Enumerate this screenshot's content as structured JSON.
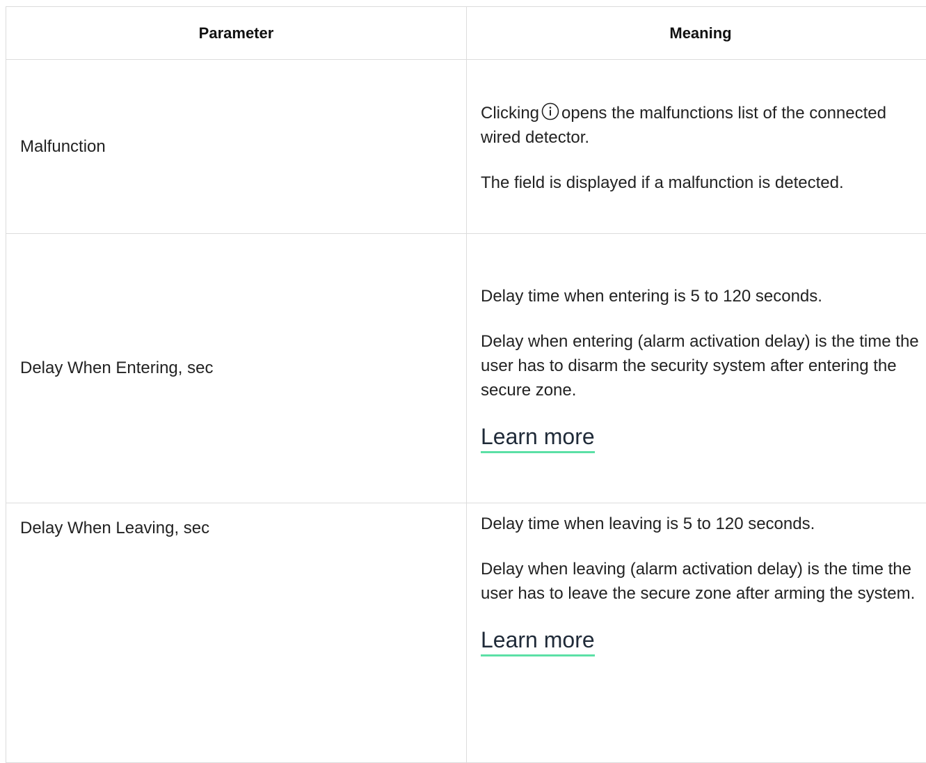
{
  "table": {
    "headers": {
      "parameter": "Parameter",
      "meaning": "Meaning"
    },
    "rows": [
      {
        "parameter": "Malfunction",
        "meaning": {
          "line1_before_icon": "Clicking",
          "line1_after_icon": "opens the malfunctions list of the connected wired detector.",
          "paragraph2": "The field is displayed if a malfunction is detected."
        }
      },
      {
        "parameter": "Delay When Entering, sec",
        "meaning": {
          "paragraph1": "Delay time when entering is 5 to 120 seconds.",
          "paragraph2": "Delay when entering (alarm activation delay) is the time the user has to disarm the security system after entering the secure zone.",
          "link": "Learn more"
        }
      },
      {
        "parameter": "Delay When Leaving, sec",
        "meaning": {
          "paragraph1": "Delay time when leaving is 5 to 120 seconds.",
          "paragraph2": "Delay when leaving (alarm activation delay) is the time the user has to leave the secure zone after arming the system.",
          "link": "Learn more"
        }
      }
    ]
  },
  "icons": {
    "info": "info-circle-icon"
  },
  "colors": {
    "link_underline": "#5be0a6",
    "border": "#dcdcdc",
    "text": "#222222"
  }
}
